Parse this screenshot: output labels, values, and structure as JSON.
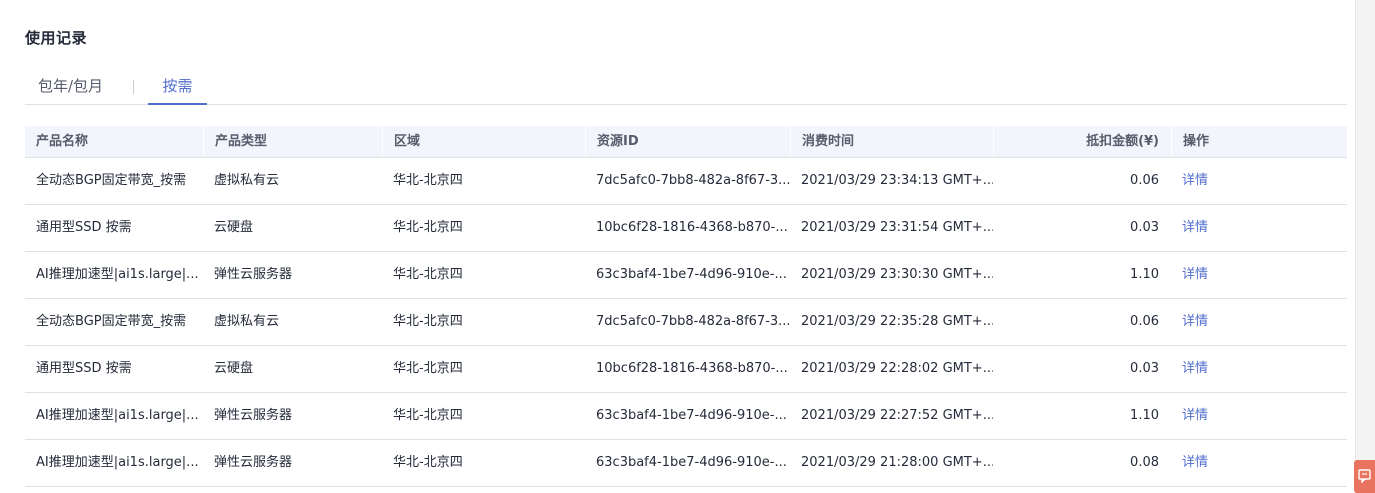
{
  "section": {
    "title": "使用记录"
  },
  "tabs": [
    {
      "label": "包年/包月",
      "active": false
    },
    {
      "label": "按需",
      "active": true
    }
  ],
  "table": {
    "headers": [
      "产品名称",
      "产品类型",
      "区域",
      "资源ID",
      "消费时间",
      "抵扣金额(¥)",
      "操作"
    ],
    "rows": [
      [
        "全动态BGP固定带宽_按需",
        "虚拟私有云",
        "华北-北京四",
        "7dc5afc0-7bb8-482a-8f67-3...",
        "2021/03/29 23:34:13 GMT+...",
        "0.06",
        "详情"
      ],
      [
        "通用型SSD 按需",
        "云硬盘",
        "华北-北京四",
        "10bc6f28-1816-4368-b870-...",
        "2021/03/29 23:31:54 GMT+...",
        "0.03",
        "详情"
      ],
      [
        "AI推理加速型|ai1s.large|...",
        "弹性云服务器",
        "华北-北京四",
        "63c3baf4-1be7-4d96-910e-...",
        "2021/03/29 23:30:30 GMT+...",
        "1.10",
        "详情"
      ],
      [
        "全动态BGP固定带宽_按需",
        "虚拟私有云",
        "华北-北京四",
        "7dc5afc0-7bb8-482a-8f67-3...",
        "2021/03/29 22:35:28 GMT+...",
        "0.06",
        "详情"
      ],
      [
        "通用型SSD 按需",
        "云硬盘",
        "华北-北京四",
        "10bc6f28-1816-4368-b870-...",
        "2021/03/29 22:28:02 GMT+...",
        "0.03",
        "详情"
      ],
      [
        "AI推理加速型|ai1s.large|...",
        "弹性云服务器",
        "华北-北京四",
        "63c3baf4-1be7-4d96-910e-...",
        "2021/03/29 22:27:52 GMT+...",
        "1.10",
        "详情"
      ],
      [
        "AI推理加速型|ai1s.large|...",
        "弹性云服务器",
        "华北-北京四",
        "63c3baf4-1be7-4d96-910e-...",
        "2021/03/29 21:28:00 GMT+...",
        "0.08",
        "详情"
      ]
    ]
  },
  "colors": {
    "accent": "#526ecc",
    "header_bg": "#f2f5fc",
    "float_button": "#e8735f"
  },
  "icons": {
    "float_button": "feedback-icon"
  }
}
